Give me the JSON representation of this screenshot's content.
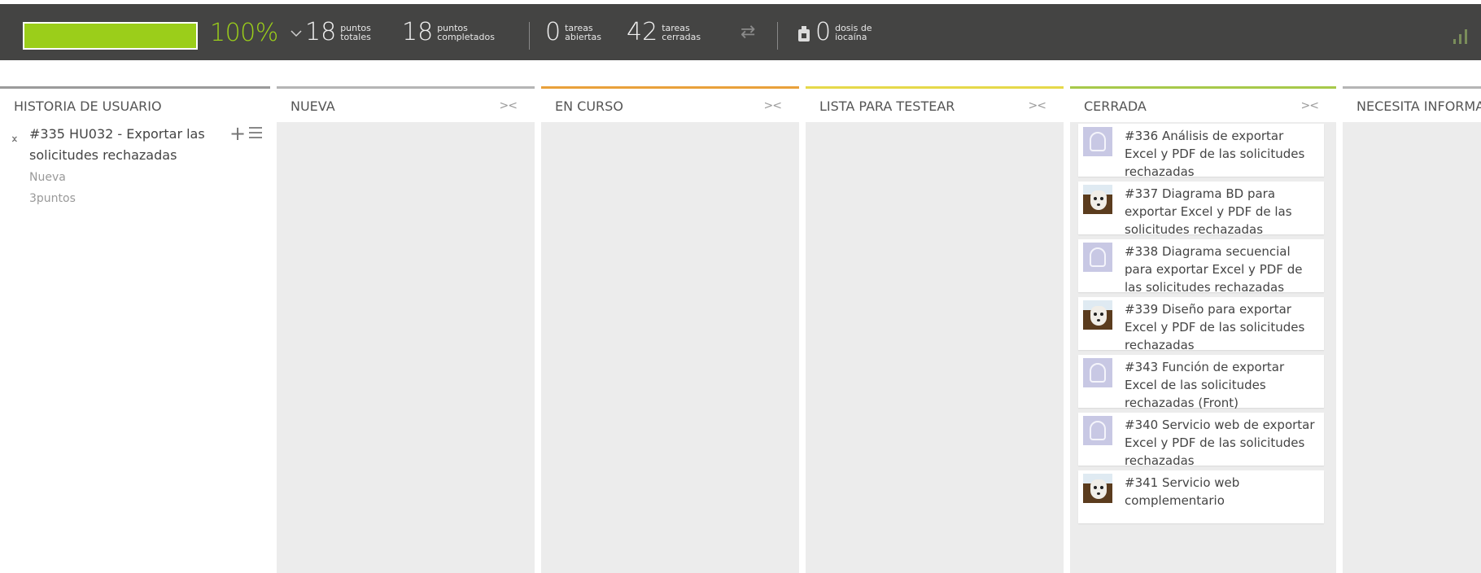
{
  "stats": {
    "progress_fraction": 1.0,
    "progress_pct": "100%",
    "total_points": {
      "value": "18",
      "label": [
        "puntos",
        "totales"
      ]
    },
    "completed_points": {
      "value": "18",
      "label": [
        "puntos",
        "completados"
      ]
    },
    "open_tasks": {
      "value": "0",
      "label": [
        "tareas",
        "abiertas"
      ]
    },
    "closed_tasks": {
      "value": "42",
      "label": [
        "tareas",
        "cerradas"
      ]
    },
    "iocaine": {
      "value": "0",
      "label": [
        "dosis de",
        "iocaína"
      ]
    }
  },
  "colors": {
    "bar_bg": "#444443",
    "progress_green": "#9bce1a",
    "col_en_curso": "#e9a13b",
    "col_lista_testear": "#e6d94a",
    "col_cerrada": "#a7c94a"
  },
  "columns": [
    {
      "title": "HISTORIA DE USUARIO"
    },
    {
      "title": "NUEVA",
      "fold": "><"
    },
    {
      "title": "EN CURSO",
      "fold": "><"
    },
    {
      "title": "LISTA PARA TESTEAR",
      "fold": "><"
    },
    {
      "title": "CERRADA",
      "fold": "><"
    },
    {
      "title": "NECESITA INFORMA"
    }
  ],
  "user_story": {
    "ref": "#335",
    "title": "#335 HU032 - Exportar las solicitudes rechazadas",
    "status": "Nueva",
    "points": "3puntos"
  },
  "tasks": [
    {
      "text": "#336 Análisis de exportar Excel y PDF de las solicitudes rechazadas",
      "avatar": "default"
    },
    {
      "text": "#337 Diagrama BD para exportar Excel y PDF de las solicitudes rechazadas",
      "avatar": "dog"
    },
    {
      "text": "#338 Diagrama secuencial para exportar Excel y PDF de las solicitudes rechazadas",
      "avatar": "default"
    },
    {
      "text": "#339 Diseño para exportar Excel y PDF de las solicitudes rechazadas",
      "avatar": "dog"
    },
    {
      "text": "#343 Función de exportar Excel de las solicitudes rechazadas (Front)",
      "avatar": "default"
    },
    {
      "text": "#340 Servicio web de exportar Excel y PDF de las solicitudes rechazadas",
      "avatar": "default"
    },
    {
      "text": "#341 Servicio web complementario",
      "avatar": "dog"
    }
  ]
}
